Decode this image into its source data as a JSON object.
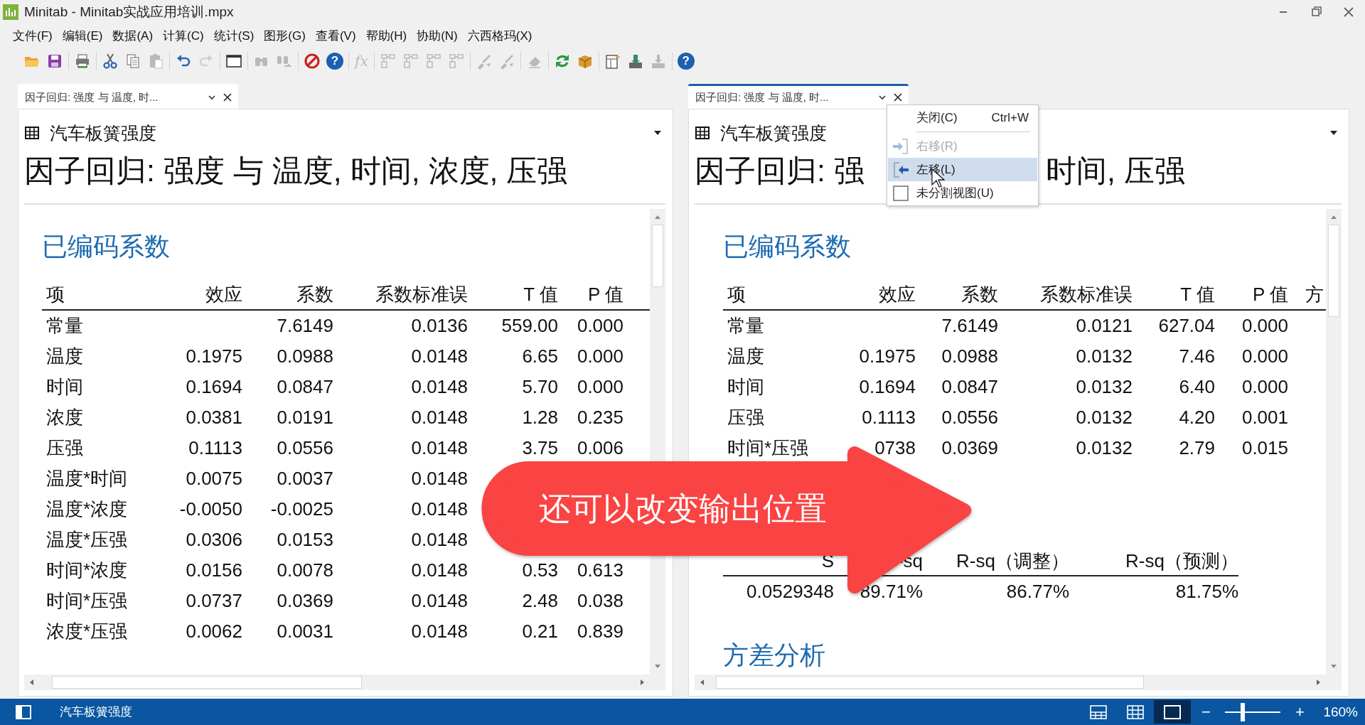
{
  "window": {
    "title": "Minitab - Minitab实战应用培训.mpx"
  },
  "menu": [
    "文件(F)",
    "编辑(E)",
    "数据(A)",
    "计算(C)",
    "统计(S)",
    "图形(G)",
    "查看(V)",
    "帮助(H)",
    "协助(N)",
    "六西格玛(X)"
  ],
  "toolbar": [
    [
      {
        "kind": "open",
        "disabled": false
      },
      {
        "kind": "save",
        "disabled": false
      }
    ],
    [
      {
        "kind": "print",
        "disabled": false
      }
    ],
    [
      {
        "kind": "cut",
        "disabled": false
      },
      {
        "kind": "copy",
        "disabled": false
      },
      {
        "kind": "paste",
        "disabled": true
      }
    ],
    [
      {
        "kind": "undo",
        "disabled": false
      },
      {
        "kind": "redo",
        "disabled": true
      }
    ],
    [
      {
        "kind": "window",
        "disabled": false
      }
    ],
    [
      {
        "kind": "find",
        "disabled": true
      },
      {
        "kind": "replace",
        "disabled": true
      }
    ],
    [
      {
        "kind": "stop",
        "disabled": false
      },
      {
        "kind": "help",
        "glyph": "?",
        "disabled": false
      }
    ],
    [
      {
        "kind": "function",
        "glyph": "fx",
        "disabled": true
      }
    ],
    [
      {
        "kind": "layout",
        "disabled": true
      },
      {
        "kind": "layout",
        "disabled": true
      },
      {
        "kind": "layout",
        "disabled": true
      },
      {
        "kind": "layout",
        "disabled": true
      }
    ],
    [
      {
        "kind": "brush",
        "disabled": true
      },
      {
        "kind": "brush",
        "disabled": true
      }
    ],
    [
      {
        "kind": "eraser",
        "disabled": true
      }
    ],
    [
      {
        "kind": "refresh",
        "disabled": false
      },
      {
        "kind": "box",
        "disabled": false
      }
    ],
    [
      {
        "kind": "newdoc",
        "disabled": false
      },
      {
        "kind": "report",
        "disabled": false
      },
      {
        "kind": "download",
        "disabled": true
      }
    ],
    [
      {
        "kind": "help",
        "glyph": "?",
        "disabled": false
      }
    ]
  ],
  "panels": [
    {
      "tab": {
        "label": "因子回归: 强度 与 温度, 时...",
        "selected": false
      },
      "worksheet": "汽车板簧强度",
      "title": [
        "因子回归: 强度 与 温度, 时间, 浓度, 压强"
      ],
      "sections": [
        {
          "kind": "coef",
          "heading": "已编码系数",
          "columns": [
            "项",
            "效应",
            "系数",
            "系数标准误",
            "T 值",
            "P 值"
          ],
          "rows": [
            [
              "常量",
              null,
              "7.6149",
              "0.0136",
              "559.00",
              "0.000"
            ],
            [
              "温度",
              "0.1975",
              "0.0988",
              "0.0148",
              "6.65",
              "0.000"
            ],
            [
              "时间",
              "0.1694",
              "0.0847",
              "0.0148",
              "5.70",
              "0.000"
            ],
            [
              "浓度",
              "0.0381",
              "0.0191",
              "0.0148",
              "1.28",
              "0.235"
            ],
            [
              "压强",
              "0.1113",
              "0.0556",
              "0.0148",
              "3.75",
              "0.006"
            ],
            [
              "温度*时间",
              "0.0075",
              "0.0037",
              "0.0148",
              null,
              null
            ],
            [
              "温度*浓度",
              "-0.0050",
              "-0.0025",
              "0.0148",
              null,
              null
            ],
            [
              "温度*压强",
              "0.0306",
              "0.0153",
              "0.0148",
              null,
              null
            ],
            [
              "时间*浓度",
              "0.0156",
              "0.0078",
              "0.0148",
              "0.53",
              "0.613"
            ],
            [
              "时间*压强",
              "0.0737",
              "0.0369",
              "0.0148",
              "2.48",
              "0.038"
            ],
            [
              "浓度*压强",
              "0.0062",
              "0.0031",
              "0.0148",
              "0.21",
              "0.839"
            ]
          ]
        }
      ]
    },
    {
      "tab": {
        "label": "因子回归: 强度 与 温度, 时...",
        "selected": true
      },
      "worksheet": "汽车板簧强度",
      "title": [
        "因子回归: 强",
        "时间, 压强"
      ],
      "sections": [
        {
          "kind": "coef",
          "heading": "已编码系数",
          "columns": [
            "项",
            "效应",
            "系数",
            "系数标准误",
            "T 值",
            "P 值",
            "方"
          ],
          "rows": [
            [
              "常量",
              null,
              "7.6149",
              "0.0121",
              "627.04",
              "0.000"
            ],
            [
              "温度",
              "0.1975",
              "0.0988",
              "0.0132",
              "7.46",
              "0.000"
            ],
            [
              "时间",
              "0.1694",
              "0.0847",
              "0.0132",
              "6.40",
              "0.000"
            ],
            [
              "压强",
              "0.1113",
              "0.0556",
              "0.0132",
              "4.20",
              "0.001"
            ],
            [
              "时间*压强",
              "0738",
              "0.0369",
              "0.0132",
              "2.79",
              "0.015"
            ]
          ]
        },
        {
          "kind": "summary",
          "columns": [
            "S",
            "-sq",
            "R-sq（调整）",
            "R-sq（预测）"
          ],
          "rows": [
            [
              "0.0529348",
              "89.71%",
              "86.77%",
              "81.75%"
            ]
          ]
        },
        {
          "kind": "heading",
          "heading": "方差分析"
        }
      ]
    }
  ],
  "context_menu": [
    {
      "kind": "plain",
      "label": "关闭(C)",
      "shortcut": "Ctrl+W",
      "disabled": false,
      "selected": false
    },
    {
      "kind": "separator"
    },
    {
      "kind": "move-right",
      "label": "右移(R)",
      "disabled": true,
      "selected": false
    },
    {
      "kind": "move-left",
      "label": "左移(L)",
      "disabled": false,
      "selected": true
    },
    {
      "kind": "single",
      "label": "未分割视图(U)",
      "disabled": false,
      "selected": false
    }
  ],
  "callout": {
    "text": "还可以改变输出位置"
  },
  "status": {
    "worksheet": "汽车板簧强度",
    "views": [
      {
        "kind": "split",
        "selected": false
      },
      {
        "kind": "grid",
        "selected": false
      },
      {
        "kind": "single",
        "selected": true
      }
    ],
    "zoom": {
      "minus": "−",
      "plus": "+",
      "level": 0.31,
      "reading": "160%"
    }
  }
}
